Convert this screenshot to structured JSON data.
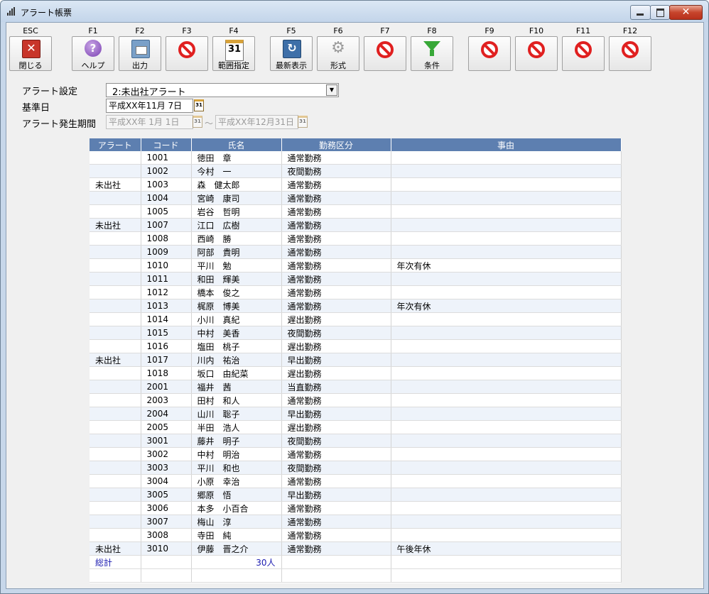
{
  "window": {
    "title": "アラート帳票"
  },
  "toolbar": {
    "keys": [
      {
        "key": "ESC",
        "label": "閉じる",
        "icon": "close-icon"
      },
      {
        "key": "F1",
        "label": "ヘルプ",
        "icon": "help-icon"
      },
      {
        "key": "F2",
        "label": "出力",
        "icon": "print-icon"
      },
      {
        "key": "F3",
        "label": "",
        "icon": "disabled-icon"
      },
      {
        "key": "F4",
        "label": "範囲指定",
        "icon": "calendar-icon"
      },
      {
        "key": "F5",
        "label": "最新表示",
        "icon": "refresh-icon"
      },
      {
        "key": "F6",
        "label": "形式",
        "icon": "gear-icon"
      },
      {
        "key": "F7",
        "label": "",
        "icon": "disabled-icon"
      },
      {
        "key": "F8",
        "label": "条件",
        "icon": "filter-icon"
      },
      {
        "key": "F9",
        "label": "",
        "icon": "disabled-icon"
      },
      {
        "key": "F10",
        "label": "",
        "icon": "disabled-icon"
      },
      {
        "key": "F11",
        "label": "",
        "icon": "disabled-icon"
      },
      {
        "key": "F12",
        "label": "",
        "icon": "disabled-icon"
      }
    ],
    "help_glyph": "?",
    "calendar_glyph": "31"
  },
  "form": {
    "alert_setting_label": "アラート設定",
    "alert_setting_value": "2:未出社アラート",
    "base_date_label": "基準日",
    "base_date_value": "平成XX年11月 7日",
    "period_label": "アラート発生期間",
    "period_from": "平成XX年 1月 1日",
    "period_separator": "～",
    "period_to": "平成XX年12月31日"
  },
  "table": {
    "columns": [
      "アラート",
      "コード",
      "氏名",
      "勤務区分",
      "事由"
    ],
    "rows": [
      [
        "",
        "1001",
        "徳田　章",
        "通常勤務",
        ""
      ],
      [
        "",
        "1002",
        "今村　一",
        "夜間勤務",
        ""
      ],
      [
        "未出社",
        "1003",
        "森　健太郎",
        "通常勤務",
        ""
      ],
      [
        "",
        "1004",
        "宮崎　康司",
        "通常勤務",
        ""
      ],
      [
        "",
        "1005",
        "岩谷　哲明",
        "通常勤務",
        ""
      ],
      [
        "未出社",
        "1007",
        "江口　広樹",
        "通常勤務",
        ""
      ],
      [
        "",
        "1008",
        "西崎　勝",
        "通常勤務",
        ""
      ],
      [
        "",
        "1009",
        "阿部　貴明",
        "通常勤務",
        ""
      ],
      [
        "",
        "1010",
        "平川　勉",
        "通常勤務",
        "年次有休"
      ],
      [
        "",
        "1011",
        "和田　輝美",
        "通常勤務",
        ""
      ],
      [
        "",
        "1012",
        "橋本　俊之",
        "通常勤務",
        ""
      ],
      [
        "",
        "1013",
        "梶原　博美",
        "通常勤務",
        "年次有休"
      ],
      [
        "",
        "1014",
        "小川　真紀",
        "遅出勤務",
        ""
      ],
      [
        "",
        "1015",
        "中村　美香",
        "夜間勤務",
        ""
      ],
      [
        "",
        "1016",
        "塩田　桃子",
        "遅出勤務",
        ""
      ],
      [
        "未出社",
        "1017",
        "川内　祐治",
        "早出勤務",
        ""
      ],
      [
        "",
        "1018",
        "坂口　由紀菜",
        "遅出勤務",
        ""
      ],
      [
        "",
        "2001",
        "福井　茜",
        "当直勤務",
        ""
      ],
      [
        "",
        "2003",
        "田村　和人",
        "通常勤務",
        ""
      ],
      [
        "",
        "2004",
        "山川　聡子",
        "早出勤務",
        ""
      ],
      [
        "",
        "2005",
        "半田　浩人",
        "遅出勤務",
        ""
      ],
      [
        "",
        "3001",
        "藤井　明子",
        "夜間勤務",
        ""
      ],
      [
        "",
        "3002",
        "中村　明治",
        "通常勤務",
        ""
      ],
      [
        "",
        "3003",
        "平川　和也",
        "夜間勤務",
        ""
      ],
      [
        "",
        "3004",
        "小原　幸治",
        "通常勤務",
        ""
      ],
      [
        "",
        "3005",
        "郷原　悟",
        "早出勤務",
        ""
      ],
      [
        "",
        "3006",
        "本多　小百合",
        "通常勤務",
        ""
      ],
      [
        "",
        "3007",
        "梅山　淳",
        "通常勤務",
        ""
      ],
      [
        "",
        "3008",
        "寺田　純",
        "通常勤務",
        ""
      ],
      [
        "未出社",
        "3010",
        "伊藤　晋之介",
        "通常勤務",
        "午後年休"
      ]
    ],
    "total_label": "総計",
    "total_count": "30人"
  },
  "colors": {
    "header_bg": "#5d7fb0",
    "alt_row": "#eef3fa",
    "total_text": "#1a1ab0",
    "ban_red": "#e02020"
  }
}
